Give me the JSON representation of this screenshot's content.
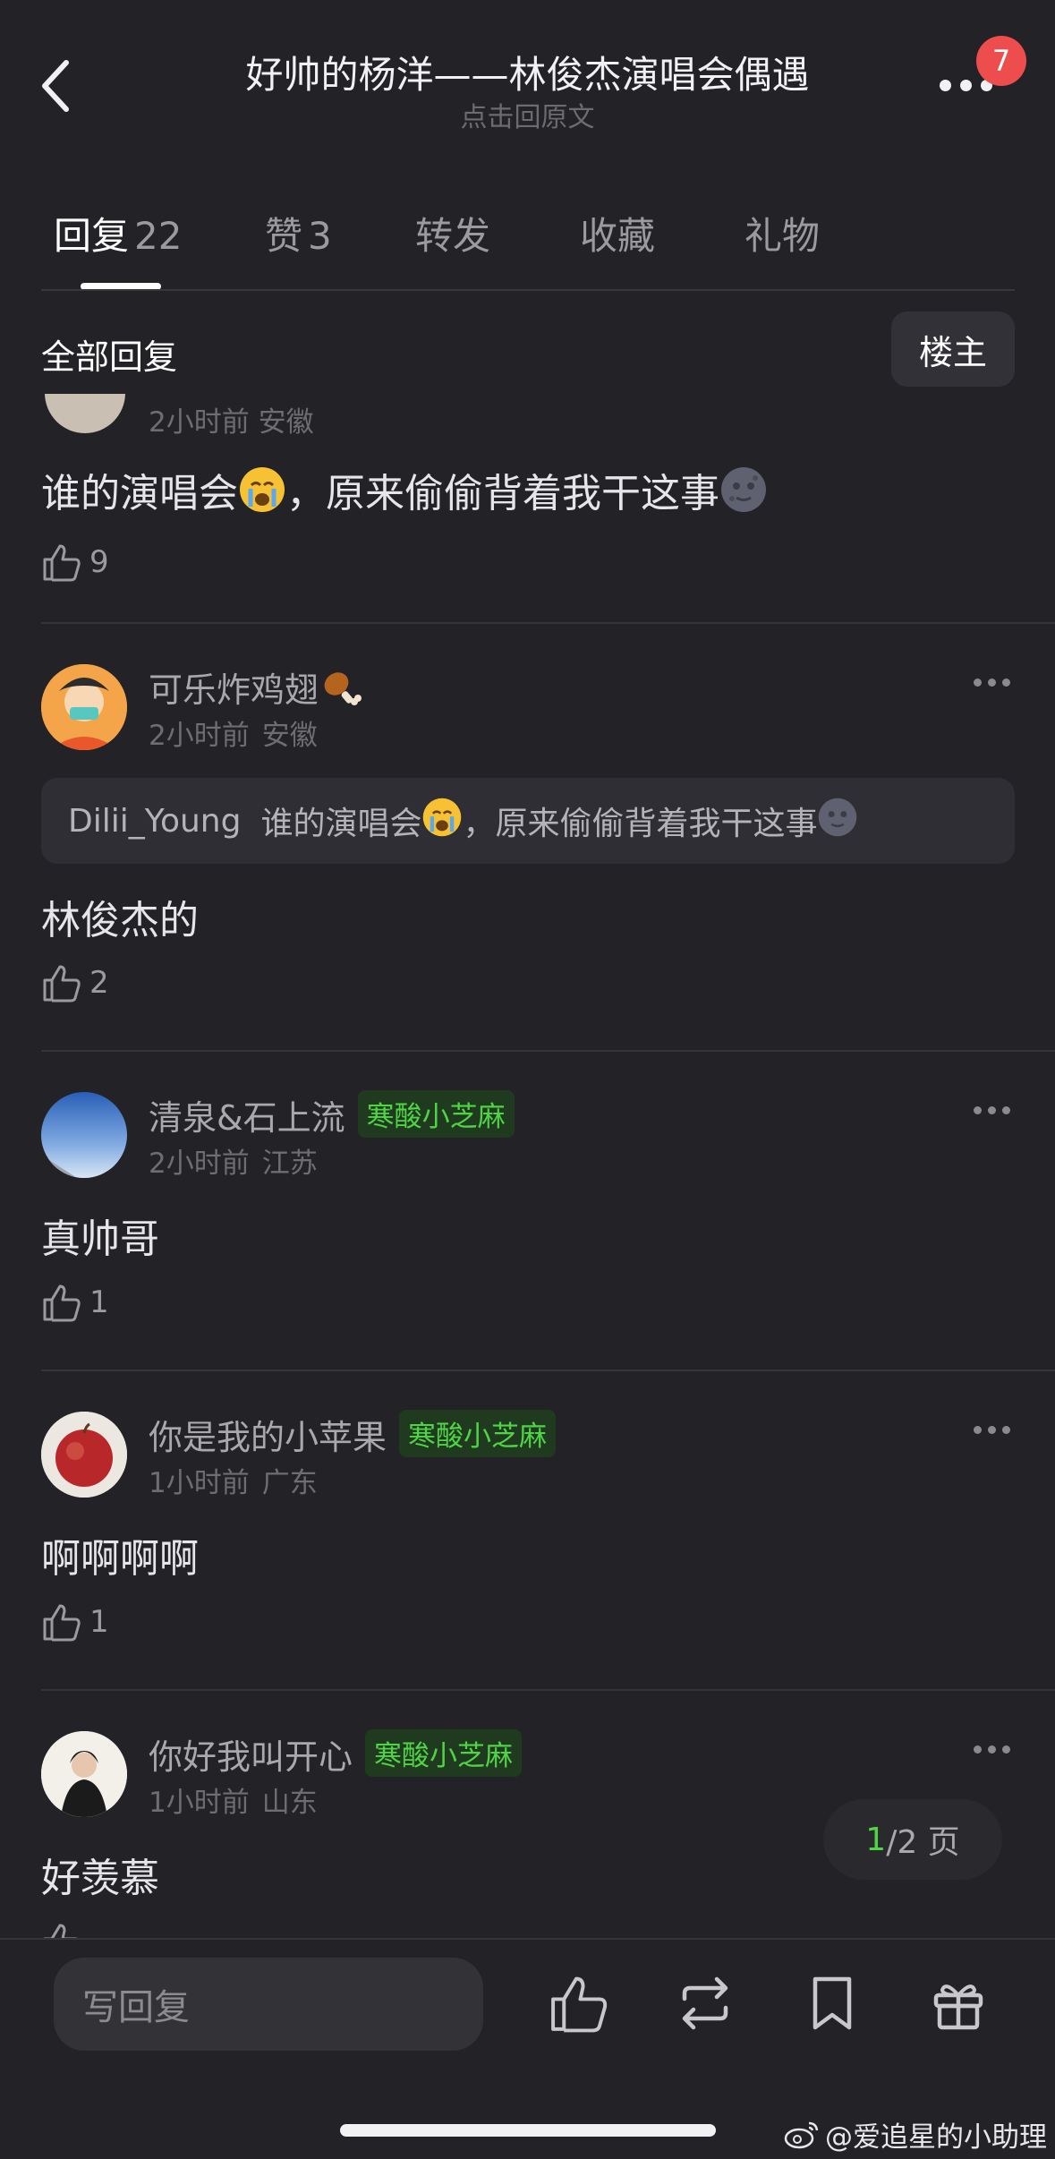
{
  "header": {
    "title": "好帅的杨洋——林俊杰演唱会偶遇",
    "subtitle": "点击回原文",
    "notification_count": "7"
  },
  "tabs": [
    {
      "label": "回复",
      "count": "22",
      "active": true
    },
    {
      "label": "赞",
      "count": "3",
      "active": false
    },
    {
      "label": "转发",
      "count": "",
      "active": false
    },
    {
      "label": "收藏",
      "count": "",
      "active": false
    },
    {
      "label": "礼物",
      "count": "",
      "active": false
    }
  ],
  "section": {
    "title": "全部回复",
    "owner_button": "楼主"
  },
  "comments": [
    {
      "meta_partial": "2小时前 安徽",
      "text": "谁的演唱会",
      "text_after": "，原来偷偷背着我干这事",
      "likes": "9"
    },
    {
      "username": "可乐炸鸡翅",
      "time": "2小时前",
      "location": "安徽",
      "quote_user": "Dilii_Young",
      "quote_text": "谁的演唱会",
      "quote_text_after": "，原来偷偷背着我干这事",
      "text": "林俊杰的",
      "likes": "2"
    },
    {
      "username": "清泉&石上流",
      "badge": "寒酸小芝麻",
      "time": "2小时前",
      "location": "江苏",
      "text": "真帅哥",
      "likes": "1"
    },
    {
      "username": "你是我的小苹果",
      "badge": "寒酸小芝麻",
      "time": "1小时前",
      "location": "广东",
      "text": "啊啊啊啊",
      "likes": "1"
    },
    {
      "username": "你好我叫开心",
      "badge": "寒酸小芝麻",
      "time": "1小时前",
      "location": "山东",
      "text": "好羡慕"
    }
  ],
  "pagination": {
    "current": "1",
    "total_text": "/2 页"
  },
  "bottom_bar": {
    "reply_placeholder": "写回复"
  },
  "watermark": "@爱追星的小助理",
  "colors": {
    "background": "#232227",
    "badge_green": "#4fd445",
    "notification_red": "#ee4d4d"
  }
}
